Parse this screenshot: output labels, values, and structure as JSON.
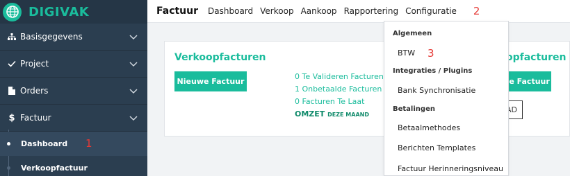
{
  "brand": {
    "name": "DIGIVAK"
  },
  "sidebar": {
    "items": [
      {
        "label": "Basisgegevens",
        "icon": "sitemap-icon"
      },
      {
        "label": "Project",
        "icon": "check-icon"
      },
      {
        "label": "Orders",
        "icon": "file-icon"
      },
      {
        "label": "Factuur",
        "icon": "dollar-icon"
      }
    ],
    "subitems": [
      {
        "label": "Dashboard",
        "active": true
      },
      {
        "label": "Verkoopfactuur",
        "active": false
      }
    ],
    "annotation": "1"
  },
  "topbar": {
    "title": "Factuur",
    "nav": [
      "Dashboard",
      "Verkoop",
      "Aankoop",
      "Rapportering",
      "Configuratie"
    ],
    "annotation": "2"
  },
  "card_left": {
    "title": "Verkoopfacturen",
    "button": "Nieuwe Factuur",
    "stats": [
      "0 Te Valideren Facturen",
      "1 Onbetaalde Facturen",
      "0 Facturen Te Laat"
    ],
    "omzet_label": "OMZET",
    "omzet_suffix": "DEZE MAAND"
  },
  "card_right": {
    "title_fragment": "opfacturen",
    "button_fragment": "we Factuur",
    "outline_fragment": "AD"
  },
  "dropdown": {
    "sections": [
      {
        "title": "Algemeen",
        "items": [
          "BTW"
        ]
      },
      {
        "title": "Integraties / Plugins",
        "items": [
          "Bank Synchronisatie"
        ]
      },
      {
        "title": "Betalingen",
        "items": [
          "Betaalmethodes",
          "Berichten Templates",
          "Factuur Herinneringsniveau"
        ]
      }
    ],
    "annotation": "3"
  },
  "colors": {
    "accent": "#1abc9c",
    "sidebar_bg": "#2b3e50",
    "annotation": "#e53935"
  }
}
